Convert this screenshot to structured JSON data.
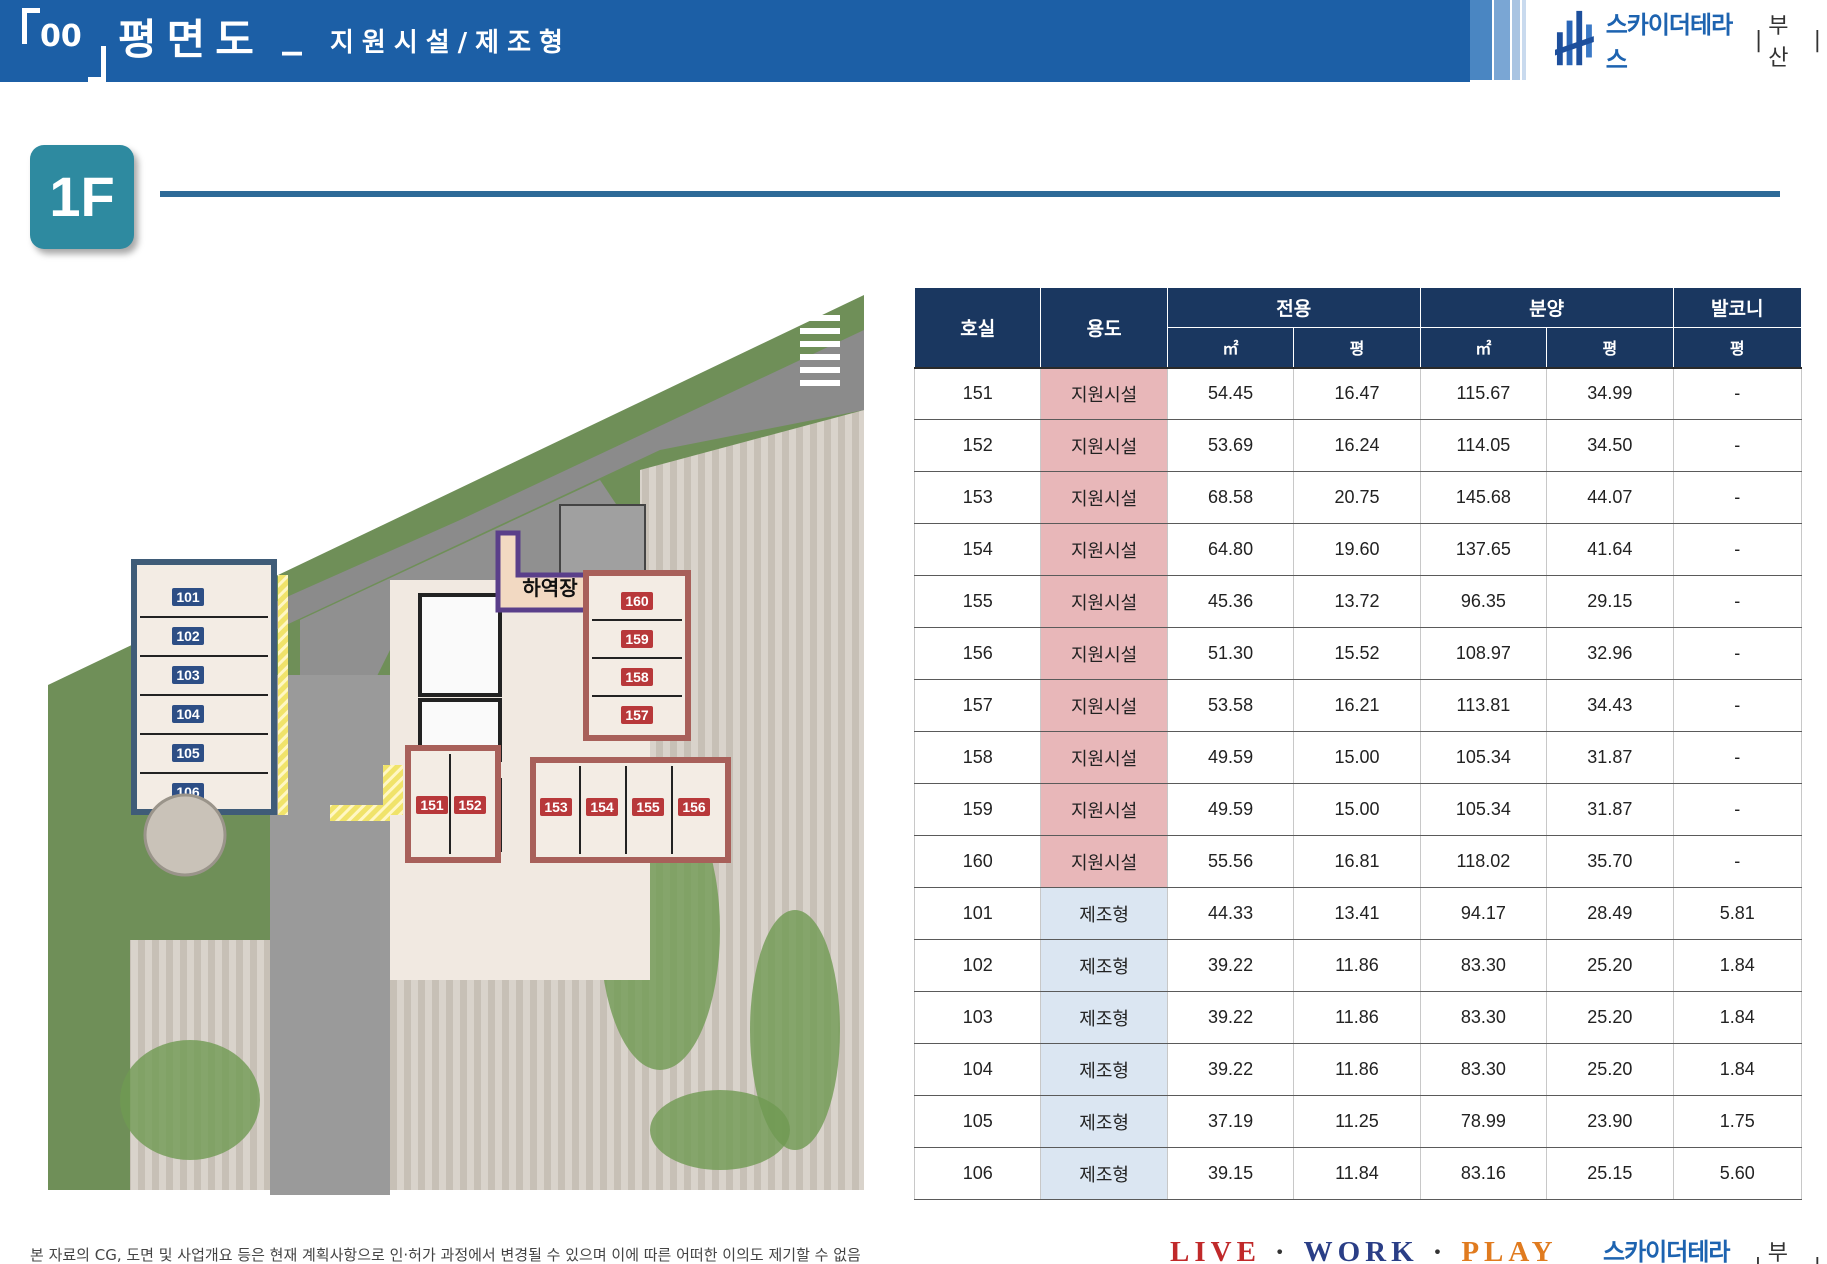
{
  "header": {
    "section_number": "00",
    "title": "평면도",
    "separator": "_",
    "subtitle": "지원시설/제조형",
    "brand": {
      "name": "스카이더테라스",
      "city": "부산"
    }
  },
  "floor": {
    "label": "1F"
  },
  "plan": {
    "units_west": [
      "101",
      "102",
      "103",
      "104",
      "105",
      "106"
    ],
    "units_east": [
      "160",
      "159",
      "158",
      "157"
    ],
    "units_south_a": [
      "151",
      "152"
    ],
    "units_south_b": [
      "153",
      "154",
      "155",
      "156"
    ],
    "loading_label": "하역장",
    "colors": {
      "west_outline": "#3f5c78",
      "support_outline": "#a8605a",
      "loading_outline": "#5a3f8a",
      "unit_badge_blue": "#2d4e85",
      "unit_badge_red": "#b8383a"
    }
  },
  "table": {
    "headers": {
      "room": "호실",
      "use": "용도",
      "exclusive": "전용",
      "sale": "분양",
      "balcony": "발코니",
      "sqm": "㎡",
      "pyeong": "평"
    },
    "rows": [
      {
        "room": "151",
        "use": "지원시설",
        "ex_sqm": "54.45",
        "ex_py": "16.47",
        "sale_sqm": "115.67",
        "sale_py": "34.99",
        "bal_py": "-"
      },
      {
        "room": "152",
        "use": "지원시설",
        "ex_sqm": "53.69",
        "ex_py": "16.24",
        "sale_sqm": "114.05",
        "sale_py": "34.50",
        "bal_py": "-"
      },
      {
        "room": "153",
        "use": "지원시설",
        "ex_sqm": "68.58",
        "ex_py": "20.75",
        "sale_sqm": "145.68",
        "sale_py": "44.07",
        "bal_py": "-"
      },
      {
        "room": "154",
        "use": "지원시설",
        "ex_sqm": "64.80",
        "ex_py": "19.60",
        "sale_sqm": "137.65",
        "sale_py": "41.64",
        "bal_py": "-"
      },
      {
        "room": "155",
        "use": "지원시설",
        "ex_sqm": "45.36",
        "ex_py": "13.72",
        "sale_sqm": "96.35",
        "sale_py": "29.15",
        "bal_py": "-"
      },
      {
        "room": "156",
        "use": "지원시설",
        "ex_sqm": "51.30",
        "ex_py": "15.52",
        "sale_sqm": "108.97",
        "sale_py": "32.96",
        "bal_py": "-"
      },
      {
        "room": "157",
        "use": "지원시설",
        "ex_sqm": "53.58",
        "ex_py": "16.21",
        "sale_sqm": "113.81",
        "sale_py": "34.43",
        "bal_py": "-"
      },
      {
        "room": "158",
        "use": "지원시설",
        "ex_sqm": "49.59",
        "ex_py": "15.00",
        "sale_sqm": "105.34",
        "sale_py": "31.87",
        "bal_py": "-"
      },
      {
        "room": "159",
        "use": "지원시설",
        "ex_sqm": "49.59",
        "ex_py": "15.00",
        "sale_sqm": "105.34",
        "sale_py": "31.87",
        "bal_py": "-"
      },
      {
        "room": "160",
        "use": "지원시설",
        "ex_sqm": "55.56",
        "ex_py": "16.81",
        "sale_sqm": "118.02",
        "sale_py": "35.70",
        "bal_py": "-"
      },
      {
        "room": "101",
        "use": "제조형",
        "ex_sqm": "44.33",
        "ex_py": "13.41",
        "sale_sqm": "94.17",
        "sale_py": "28.49",
        "bal_py": "5.81"
      },
      {
        "room": "102",
        "use": "제조형",
        "ex_sqm": "39.22",
        "ex_py": "11.86",
        "sale_sqm": "83.30",
        "sale_py": "25.20",
        "bal_py": "1.84"
      },
      {
        "room": "103",
        "use": "제조형",
        "ex_sqm": "39.22",
        "ex_py": "11.86",
        "sale_sqm": "83.30",
        "sale_py": "25.20",
        "bal_py": "1.84"
      },
      {
        "room": "104",
        "use": "제조형",
        "ex_sqm": "39.22",
        "ex_py": "11.86",
        "sale_sqm": "83.30",
        "sale_py": "25.20",
        "bal_py": "1.84"
      },
      {
        "room": "105",
        "use": "제조형",
        "ex_sqm": "37.19",
        "ex_py": "11.25",
        "sale_sqm": "78.99",
        "sale_py": "23.90",
        "bal_py": "1.75"
      },
      {
        "room": "106",
        "use": "제조형",
        "ex_sqm": "39.15",
        "ex_py": "11.84",
        "sale_sqm": "83.16",
        "sale_py": "25.15",
        "bal_py": "5.60"
      }
    ]
  },
  "footer": {
    "disclaimer": "본 자료의 CG, 도면 및 사업개요 등은 현재 계획사항으로 인·허가 과정에서 변경될 수 있으며 이에 따른 어떠한 이의도 제기할 수 없음",
    "slogan": {
      "live": "LIVE",
      "work": "WORK",
      "play": "PLAY",
      "dot": "·"
    },
    "brand": {
      "name": "스카이더테라스",
      "city": "부산"
    }
  }
}
